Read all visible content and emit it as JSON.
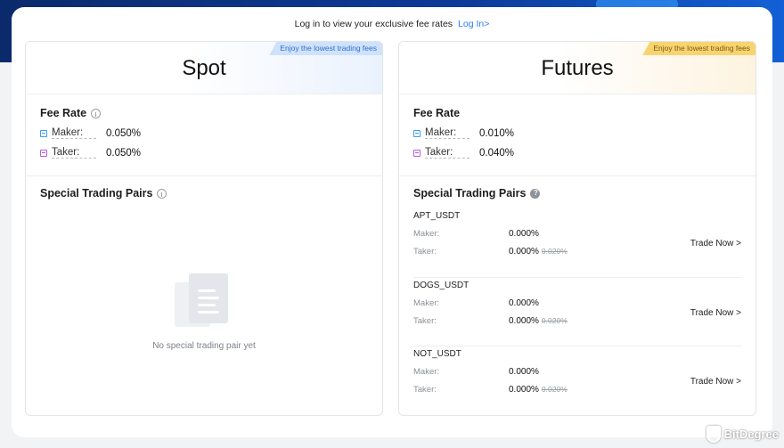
{
  "login_bar": {
    "text": "Log in to view your exclusive fee rates",
    "link": "Log In>"
  },
  "spot": {
    "title": "Spot",
    "ribbon": "Enjoy the lowest trading fees",
    "fee_rate_title": "Fee Rate",
    "maker_label": "Maker:",
    "maker_value": "0.050%",
    "taker_label": "Taker:",
    "taker_value": "0.050%",
    "pairs_title": "Special Trading Pairs",
    "empty_text": "No special trading pair yet"
  },
  "futures": {
    "title": "Futures",
    "ribbon": "Enjoy the lowest trading fees",
    "fee_rate_title": "Fee Rate",
    "maker_label": "Maker:",
    "maker_value": "0.010%",
    "taker_label": "Taker:",
    "taker_value": "0.040%",
    "pairs_title": "Special Trading Pairs",
    "pairs": [
      {
        "name": "APT_USDT",
        "maker_label": "Maker:",
        "maker_value": "0.000%",
        "taker_label": "Taker:",
        "taker_value": "0.000%",
        "taker_old": "0.020%",
        "action": "Trade Now >"
      },
      {
        "name": "DOGS_USDT",
        "maker_label": "Maker:",
        "maker_value": "0.000%",
        "taker_label": "Taker:",
        "taker_value": "0.000%",
        "taker_old": "0.020%",
        "action": "Trade Now >"
      },
      {
        "name": "NOT_USDT",
        "maker_label": "Maker:",
        "maker_value": "0.000%",
        "taker_label": "Taker:",
        "taker_value": "0.000%",
        "taker_old": "0.020%",
        "action": "Trade Now >"
      }
    ]
  },
  "watermark": "BitDegree",
  "colors": {
    "link": "#2b7cf6",
    "maker_icon": "#3b9cf0",
    "taker_icon": "#b55be0",
    "spot_ribbon": "#cfe2fb",
    "futures_ribbon": "#f8d470"
  }
}
